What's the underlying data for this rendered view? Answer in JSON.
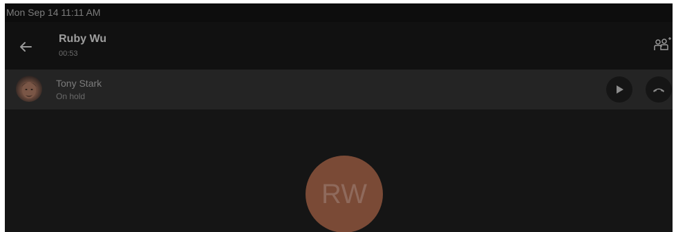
{
  "status_bar": {
    "datetime": "Mon Sep 14  11:11 AM"
  },
  "active_call": {
    "name": "Ruby Wu",
    "duration": "00:53",
    "avatar_initials": "RW",
    "avatar_color": "#7a4a36"
  },
  "held_call": {
    "name": "Tony Stark",
    "status": "On hold"
  },
  "icons": {
    "back": "arrow-left-icon",
    "add_participant": "add-participant-icon",
    "resume": "play-icon",
    "end_call": "hang-up-icon"
  },
  "colors": {
    "background": "#151515",
    "held_row": "#242424"
  }
}
